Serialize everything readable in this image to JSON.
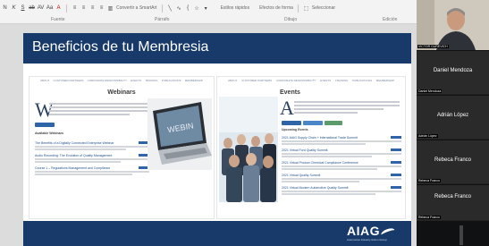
{
  "ribbon": {
    "convert_label": "Convertir a SmartArt",
    "shape_fill_label": "Relleno de forma",
    "shape_outline_label": "Contorno de forma",
    "shape_effects_label": "Efectos de forma",
    "quick_styles_label": "Estilos rápidos",
    "select_label": "Seleccionar",
    "groups": [
      "Fuente",
      "Párrafo",
      "Dibujo",
      "Edición"
    ]
  },
  "slide": {
    "title": "Beneficios de tu Membresia",
    "left_page": {
      "heading": "Webinars",
      "big_letter": "W",
      "nav": [
        "ABOUT",
        "CUSTOMER PARTNERS",
        "CORPORATE RESPONSIBILITY",
        "EVENTS",
        "TRAINING",
        "PUBLICATIONS",
        "MEMBERSHIP"
      ],
      "list_head": "Available Webinars",
      "items": [
        "The Benefits of a Digitally Connected Enterprise Webinar",
        "Audio Recording: The Evolution of Quality Management",
        "Course 1 – Regulations Management and Compliance"
      ]
    },
    "right_page": {
      "heading": "Events",
      "big_letter": "A",
      "nav": [
        "ABOUT",
        "CUSTOMER PARTNERS",
        "CORPORATE RESPONSIBILITY",
        "EVENTS",
        "TRAINING",
        "PUBLICATIONS",
        "MEMBERSHIP"
      ],
      "list_head": "Upcoming Events",
      "items": [
        "2021 AIAG Supply Chain + International Trade Summit",
        "2021 Virtual Ford Quality Summit",
        "2021 Virtual Product Chemical Compliance Conference",
        "2021 Virtual Quality Summit",
        "2021 Virtual Modern Automotive Quality Summit"
      ]
    },
    "footer": {
      "logo": "AIAG",
      "logo_sub": "Automotive Industry Action Group"
    }
  },
  "participants": [
    {
      "name": "VICTOR GUREVICH",
      "tag": "VICTOR GUREVICH",
      "kind": "video"
    },
    {
      "name": "Daniel Mendoza",
      "tag": "Daniel Mendoza",
      "kind": "name"
    },
    {
      "name": "Adrián López",
      "tag": "Adrián López",
      "kind": "name"
    },
    {
      "name": "Rebeca Franco",
      "tag": "Rebeca Franco",
      "kind": "name"
    },
    {
      "name": "Rebeca Franco",
      "tag": "Rebeca Franco",
      "kind": "name"
    }
  ],
  "colors": {
    "brand_navy": "#173a6a",
    "link_blue": "#2f64a8"
  }
}
